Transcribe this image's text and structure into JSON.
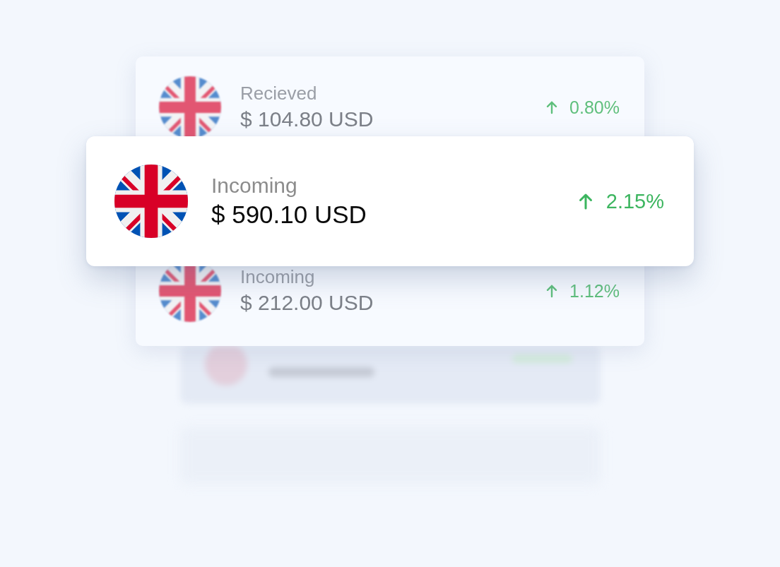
{
  "back_card": {
    "rows": [
      {
        "label": "Recieved",
        "amount": "$ 104.80 USD",
        "change": "0.80%",
        "rising": true
      },
      {
        "label": "Incoming",
        "amount": "$ 212.00 USD",
        "change": "1.12%",
        "rising": true
      }
    ]
  },
  "front_card": {
    "label": "Incoming",
    "amount": "$ 590.10 USD",
    "change": "2.15%",
    "rising": true
  }
}
